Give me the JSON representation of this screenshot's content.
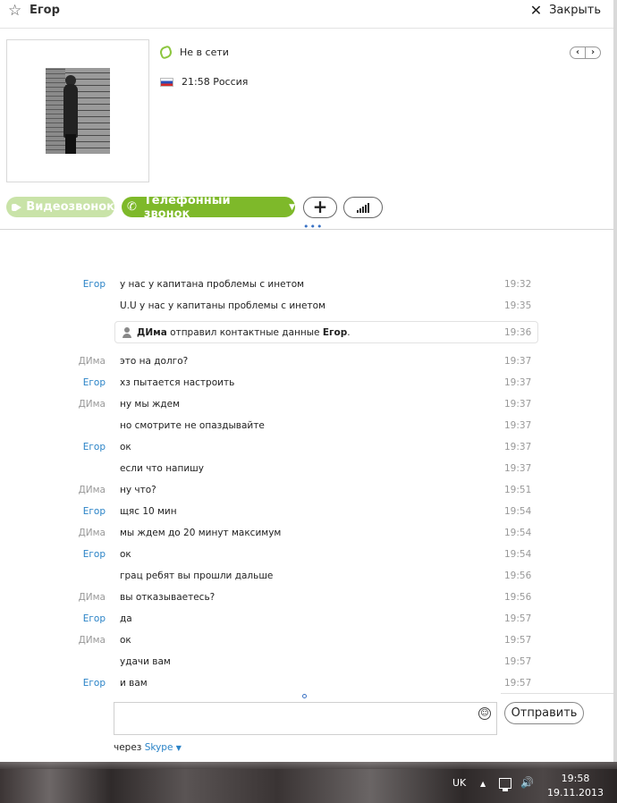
{
  "header": {
    "contact_name": "Егор",
    "close_label": "Закрыть"
  },
  "profile": {
    "status_text": "Не в сети",
    "local_time": "21:58 Россия"
  },
  "actions": {
    "video_call_label": "Видеозвонок",
    "phone_call_label": "Телефонный звонок",
    "add_icon": "plus-icon",
    "signal_icon": "signal-bars-icon"
  },
  "messages": [
    {
      "sender": "Егор",
      "sender_class": "egor",
      "text": "у нас у капитана проблемы с инетом",
      "time": "19:32"
    },
    {
      "sender": "",
      "sender_class": "egor",
      "text": "U.U у нас у капитаны проблемы с инетом",
      "time": "19:35"
    },
    {
      "sender": "ДИма",
      "sender_class": "dima",
      "text": "это на долго?",
      "time": "19:37"
    },
    {
      "sender": "Егор",
      "sender_class": "egor",
      "text": "хз пытается настроить",
      "time": "19:37"
    },
    {
      "sender": "ДИма",
      "sender_class": "dima",
      "text": "ну мы ждем",
      "time": "19:37"
    },
    {
      "sender": "",
      "sender_class": "dima",
      "text": "но смотрите не опаздывайте",
      "time": "19:37"
    },
    {
      "sender": "Егор",
      "sender_class": "egor",
      "text": "ок",
      "time": "19:37"
    },
    {
      "sender": "",
      "sender_class": "egor",
      "text": "если что напишу",
      "time": "19:37"
    },
    {
      "sender": "ДИма",
      "sender_class": "dima",
      "text": "ну что?",
      "time": "19:51"
    },
    {
      "sender": "Егор",
      "sender_class": "egor",
      "text": "щяс 10 мин",
      "time": "19:54"
    },
    {
      "sender": "ДИма",
      "sender_class": "dima",
      "text": "мы ждем до 20 минут максимум",
      "time": "19:54"
    },
    {
      "sender": "Егор",
      "sender_class": "egor",
      "text": "ок",
      "time": "19:54"
    },
    {
      "sender": "",
      "sender_class": "egor",
      "text": "грац ребят вы прошли дальше",
      "time": "19:56"
    },
    {
      "sender": "ДИма",
      "sender_class": "dima",
      "text": "вы отказываетесь?",
      "time": "19:56"
    },
    {
      "sender": "Егор",
      "sender_class": "egor",
      "text": "да",
      "time": "19:57"
    },
    {
      "sender": "ДИма",
      "sender_class": "dima",
      "text": "ок",
      "time": "19:57"
    },
    {
      "sender": "",
      "sender_class": "dima",
      "text": "удачи вам",
      "time": "19:57"
    },
    {
      "sender": "Егор",
      "sender_class": "egor",
      "text": "и вам",
      "time": "19:57"
    }
  ],
  "contact_notice": {
    "sender_name": "ДИма",
    "action_text": " отправил контактные данные ",
    "target_name": "Егор",
    "suffix": ".",
    "time": "19:36"
  },
  "composer": {
    "input_value": "",
    "send_label": "Отправить",
    "via_prefix": "через ",
    "via_service": "Skype"
  },
  "taskbar": {
    "language": "UK",
    "clock_time": "19:58",
    "clock_date": "19.11.2013"
  },
  "colors": {
    "accent_green": "#7eb92a",
    "skype_blue": "#2a83c7",
    "muted_gray": "#999999"
  }
}
